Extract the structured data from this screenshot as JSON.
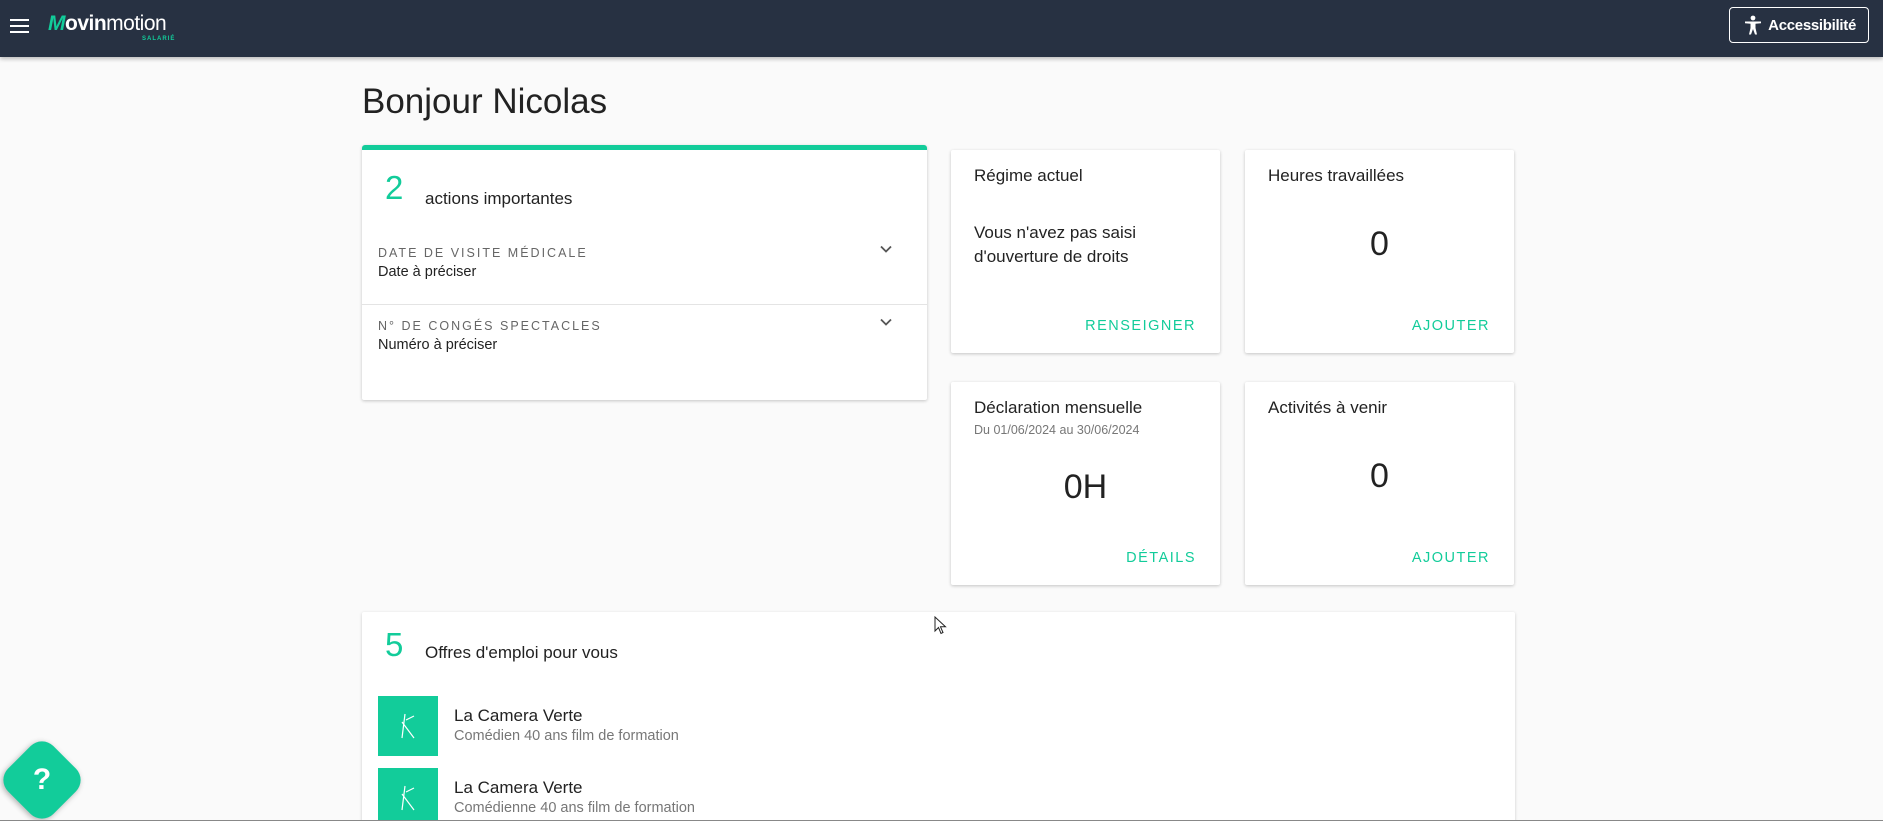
{
  "header": {
    "logo_main_bold": "ovin",
    "logo_main_light": "motion",
    "logo_sub": "SALARIÉ",
    "accessibility_label": "Accessibilité"
  },
  "page": {
    "greeting": "Bonjour Nicolas"
  },
  "actions": {
    "count": "2",
    "label": "actions importantes",
    "items": [
      {
        "kicker": "DATE DE VISITE MÉDICALE",
        "value": "Date à préciser"
      },
      {
        "kicker": "N° DE CONGÉS SPECTACLES",
        "value": "Numéro à préciser"
      }
    ]
  },
  "regime": {
    "title": "Régime actuel",
    "text_line1": "Vous n'avez pas saisi",
    "text_line2": "d'ouverture de droits",
    "action": "RENSEIGNER"
  },
  "hours": {
    "title": "Heures travaillées",
    "value": "0",
    "action": "AJOUTER"
  },
  "declaration": {
    "title": "Déclaration mensuelle",
    "period": "Du 01/06/2024 au 30/06/2024",
    "value": "0H",
    "action": "DÉTAILS"
  },
  "activities": {
    "title": "Activités à venir",
    "value": "0",
    "action": "AJOUTER"
  },
  "jobs": {
    "count": "5",
    "label": "Offres d'emploi pour vous",
    "items": [
      {
        "company": "La Camera Verte",
        "title": "Comédien 40 ans film de formation"
      },
      {
        "company": "La Camera Verte",
        "title": "Comédienne 40 ans film de formation"
      }
    ]
  },
  "help": {
    "label": "?"
  },
  "colors": {
    "accent": "#12cc9a",
    "topbar": "#273142"
  }
}
